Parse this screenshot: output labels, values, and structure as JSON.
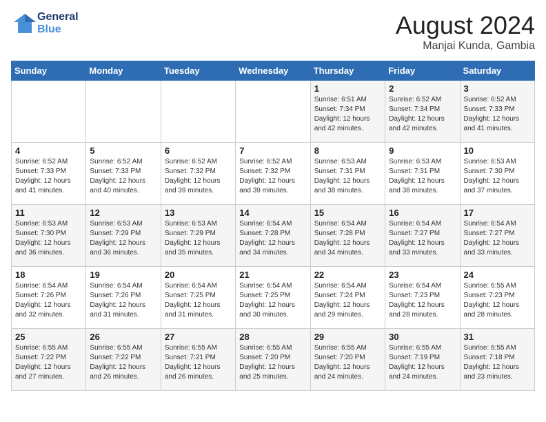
{
  "header": {
    "logo_line1": "General",
    "logo_line2": "Blue",
    "month_year": "August 2024",
    "location": "Manjai Kunda, Gambia"
  },
  "days_of_week": [
    "Sunday",
    "Monday",
    "Tuesday",
    "Wednesday",
    "Thursday",
    "Friday",
    "Saturday"
  ],
  "weeks": [
    [
      {
        "num": "",
        "info": ""
      },
      {
        "num": "",
        "info": ""
      },
      {
        "num": "",
        "info": ""
      },
      {
        "num": "",
        "info": ""
      },
      {
        "num": "1",
        "info": "Sunrise: 6:51 AM\nSunset: 7:34 PM\nDaylight: 12 hours\nand 42 minutes."
      },
      {
        "num": "2",
        "info": "Sunrise: 6:52 AM\nSunset: 7:34 PM\nDaylight: 12 hours\nand 42 minutes."
      },
      {
        "num": "3",
        "info": "Sunrise: 6:52 AM\nSunset: 7:33 PM\nDaylight: 12 hours\nand 41 minutes."
      }
    ],
    [
      {
        "num": "4",
        "info": "Sunrise: 6:52 AM\nSunset: 7:33 PM\nDaylight: 12 hours\nand 41 minutes."
      },
      {
        "num": "5",
        "info": "Sunrise: 6:52 AM\nSunset: 7:33 PM\nDaylight: 12 hours\nand 40 minutes."
      },
      {
        "num": "6",
        "info": "Sunrise: 6:52 AM\nSunset: 7:32 PM\nDaylight: 12 hours\nand 39 minutes."
      },
      {
        "num": "7",
        "info": "Sunrise: 6:52 AM\nSunset: 7:32 PM\nDaylight: 12 hours\nand 39 minutes."
      },
      {
        "num": "8",
        "info": "Sunrise: 6:53 AM\nSunset: 7:31 PM\nDaylight: 12 hours\nand 38 minutes."
      },
      {
        "num": "9",
        "info": "Sunrise: 6:53 AM\nSunset: 7:31 PM\nDaylight: 12 hours\nand 38 minutes."
      },
      {
        "num": "10",
        "info": "Sunrise: 6:53 AM\nSunset: 7:30 PM\nDaylight: 12 hours\nand 37 minutes."
      }
    ],
    [
      {
        "num": "11",
        "info": "Sunrise: 6:53 AM\nSunset: 7:30 PM\nDaylight: 12 hours\nand 36 minutes."
      },
      {
        "num": "12",
        "info": "Sunrise: 6:53 AM\nSunset: 7:29 PM\nDaylight: 12 hours\nand 36 minutes."
      },
      {
        "num": "13",
        "info": "Sunrise: 6:53 AM\nSunset: 7:29 PM\nDaylight: 12 hours\nand 35 minutes."
      },
      {
        "num": "14",
        "info": "Sunrise: 6:54 AM\nSunset: 7:28 PM\nDaylight: 12 hours\nand 34 minutes."
      },
      {
        "num": "15",
        "info": "Sunrise: 6:54 AM\nSunset: 7:28 PM\nDaylight: 12 hours\nand 34 minutes."
      },
      {
        "num": "16",
        "info": "Sunrise: 6:54 AM\nSunset: 7:27 PM\nDaylight: 12 hours\nand 33 minutes."
      },
      {
        "num": "17",
        "info": "Sunrise: 6:54 AM\nSunset: 7:27 PM\nDaylight: 12 hours\nand 33 minutes."
      }
    ],
    [
      {
        "num": "18",
        "info": "Sunrise: 6:54 AM\nSunset: 7:26 PM\nDaylight: 12 hours\nand 32 minutes."
      },
      {
        "num": "19",
        "info": "Sunrise: 6:54 AM\nSunset: 7:26 PM\nDaylight: 12 hours\nand 31 minutes."
      },
      {
        "num": "20",
        "info": "Sunrise: 6:54 AM\nSunset: 7:25 PM\nDaylight: 12 hours\nand 31 minutes."
      },
      {
        "num": "21",
        "info": "Sunrise: 6:54 AM\nSunset: 7:25 PM\nDaylight: 12 hours\nand 30 minutes."
      },
      {
        "num": "22",
        "info": "Sunrise: 6:54 AM\nSunset: 7:24 PM\nDaylight: 12 hours\nand 29 minutes."
      },
      {
        "num": "23",
        "info": "Sunrise: 6:54 AM\nSunset: 7:23 PM\nDaylight: 12 hours\nand 28 minutes."
      },
      {
        "num": "24",
        "info": "Sunrise: 6:55 AM\nSunset: 7:23 PM\nDaylight: 12 hours\nand 28 minutes."
      }
    ],
    [
      {
        "num": "25",
        "info": "Sunrise: 6:55 AM\nSunset: 7:22 PM\nDaylight: 12 hours\nand 27 minutes."
      },
      {
        "num": "26",
        "info": "Sunrise: 6:55 AM\nSunset: 7:22 PM\nDaylight: 12 hours\nand 26 minutes."
      },
      {
        "num": "27",
        "info": "Sunrise: 6:55 AM\nSunset: 7:21 PM\nDaylight: 12 hours\nand 26 minutes."
      },
      {
        "num": "28",
        "info": "Sunrise: 6:55 AM\nSunset: 7:20 PM\nDaylight: 12 hours\nand 25 minutes."
      },
      {
        "num": "29",
        "info": "Sunrise: 6:55 AM\nSunset: 7:20 PM\nDaylight: 12 hours\nand 24 minutes."
      },
      {
        "num": "30",
        "info": "Sunrise: 6:55 AM\nSunset: 7:19 PM\nDaylight: 12 hours\nand 24 minutes."
      },
      {
        "num": "31",
        "info": "Sunrise: 6:55 AM\nSunset: 7:18 PM\nDaylight: 12 hours\nand 23 minutes."
      }
    ]
  ]
}
